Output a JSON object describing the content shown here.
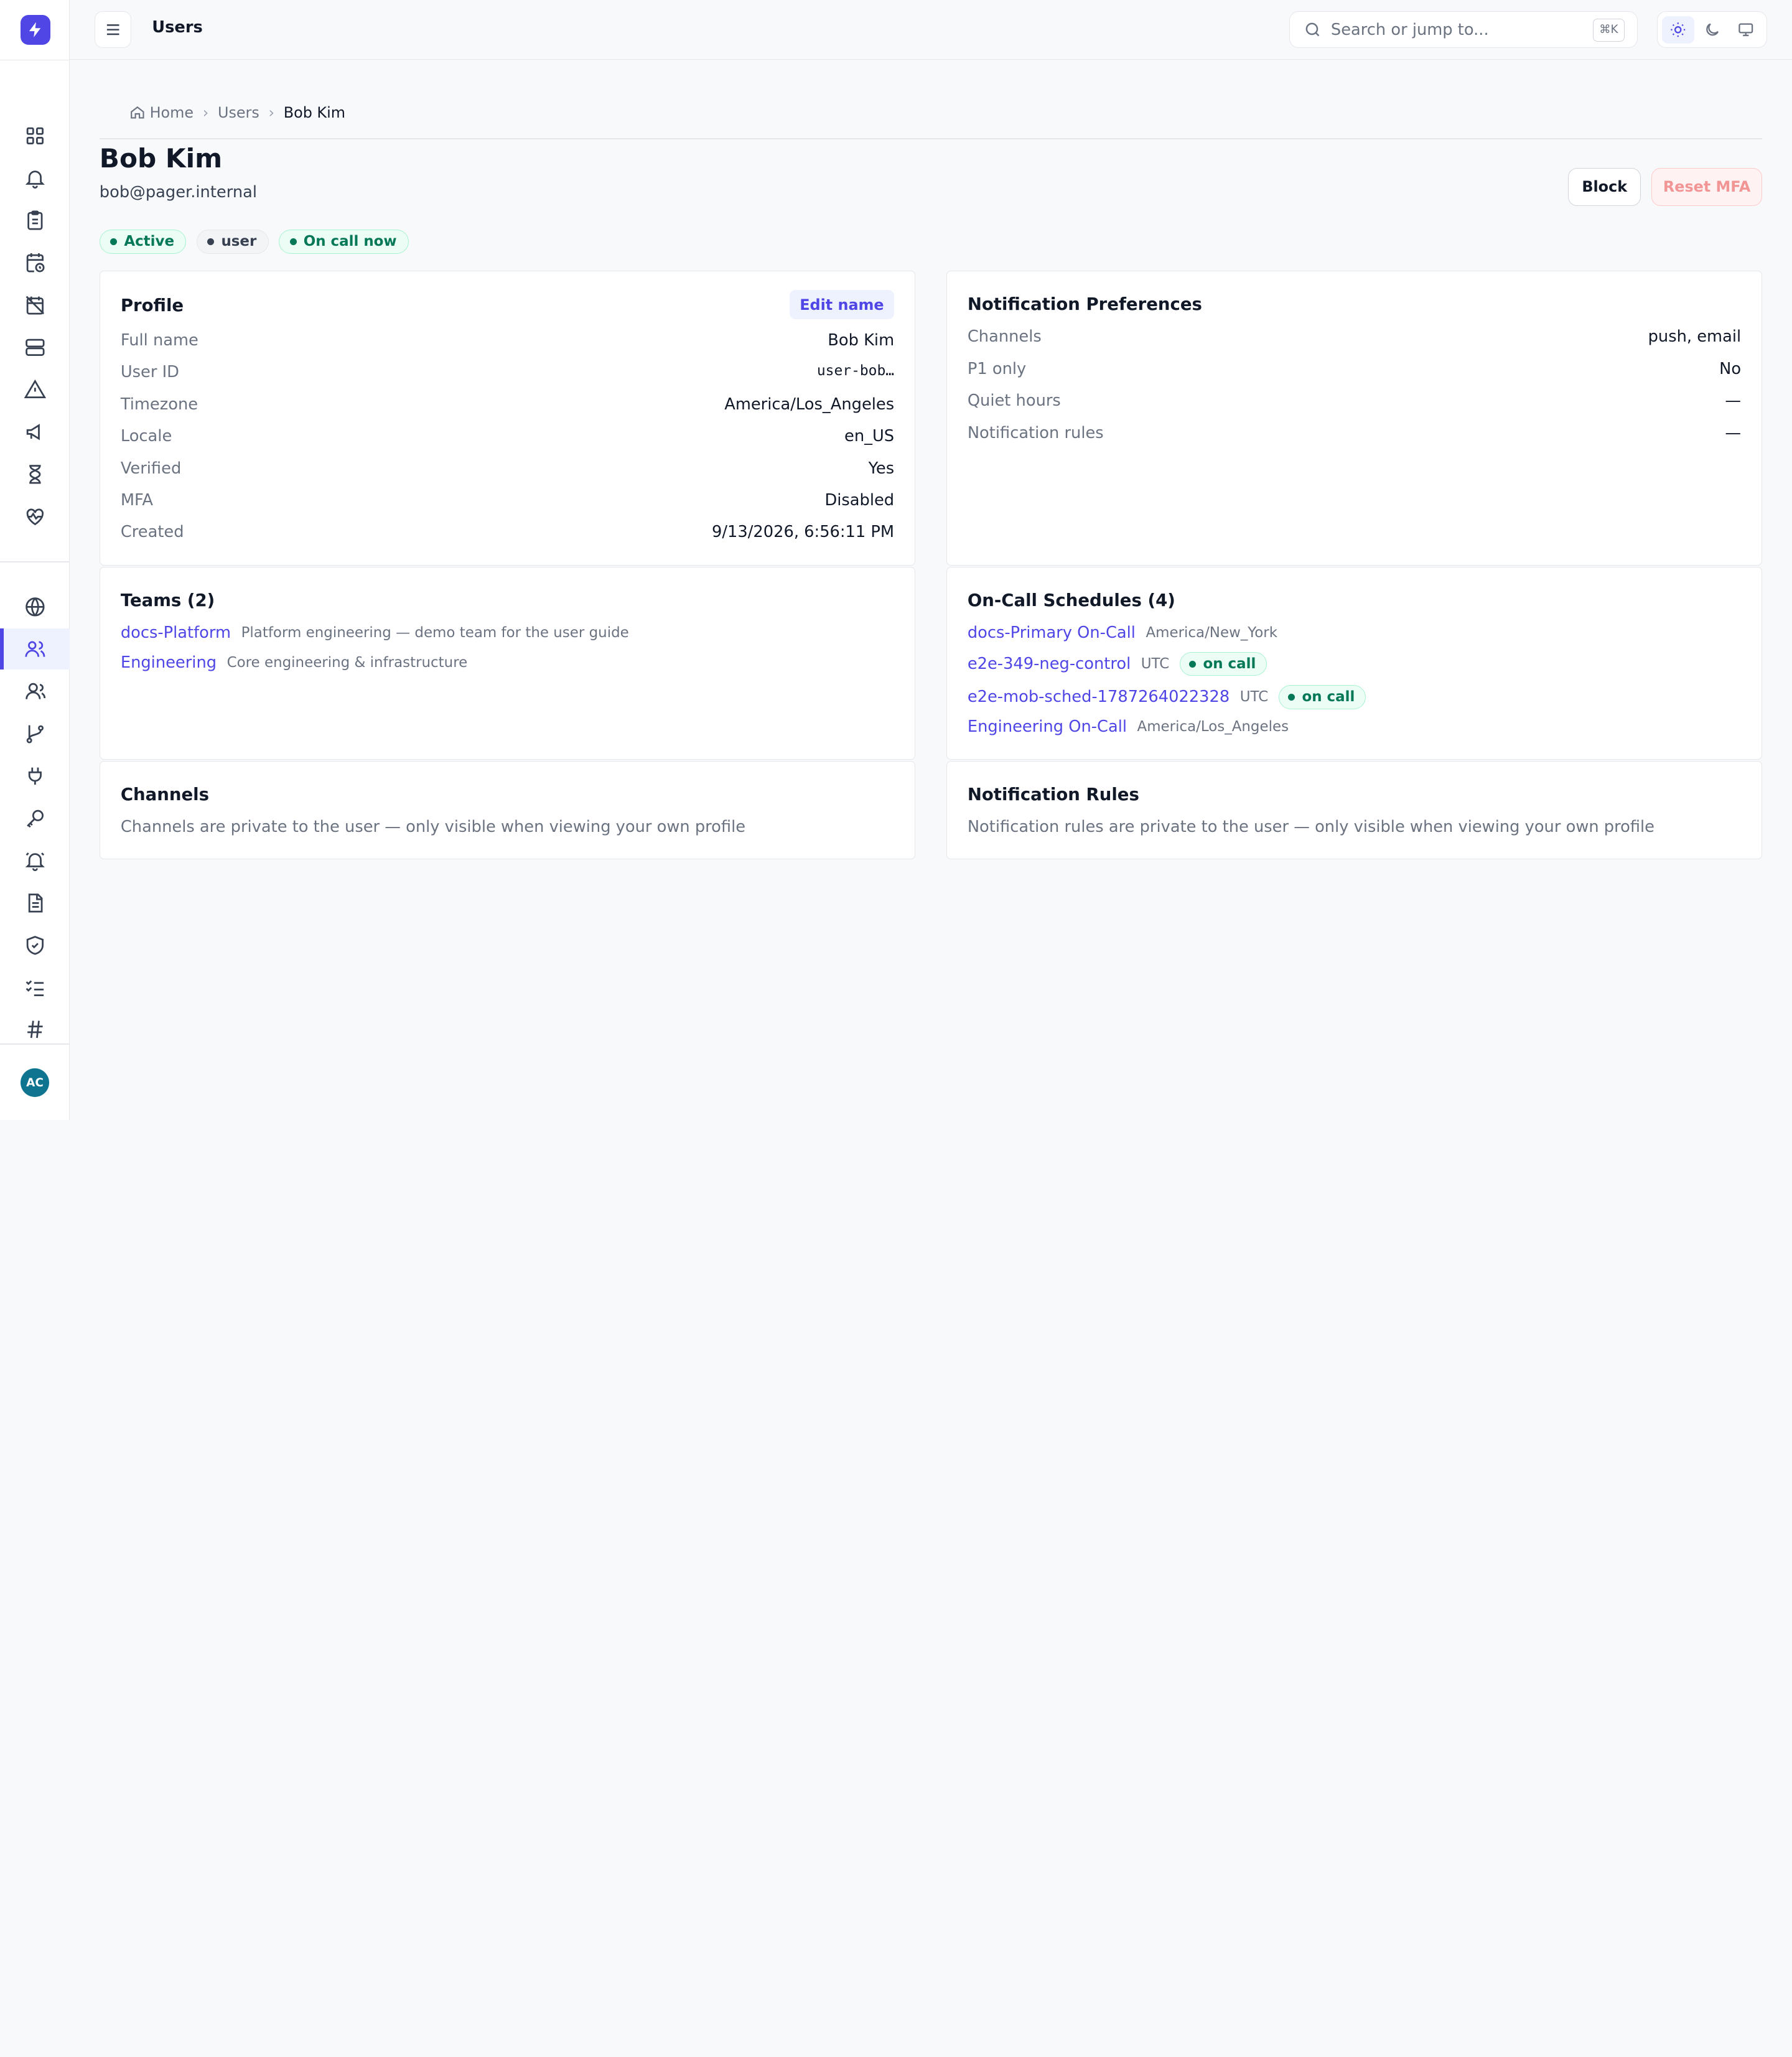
{
  "app": {
    "avatar_initials": "AC",
    "accent_color": "#4f46e5"
  },
  "topbar": {
    "title": "Users",
    "search_placeholder": "Search or jump to...",
    "search_shortcut": "⌘K"
  },
  "breadcrumb": {
    "home": "Home",
    "users": "Users",
    "current": "Bob Kim"
  },
  "user": {
    "name": "Bob Kim",
    "email": "bob@pager.internal",
    "badges": [
      "Active",
      "user",
      "On call now"
    ]
  },
  "actions": {
    "block": "Block",
    "reset_mfa": "Reset MFA"
  },
  "profile": {
    "title": "Profile",
    "edit_label": "Edit name",
    "rows": [
      {
        "key": "Full name",
        "value": "Bob Kim"
      },
      {
        "key": "User ID",
        "value": "user-bob…"
      },
      {
        "key": "Timezone",
        "value": "America/Los_Angeles"
      },
      {
        "key": "Locale",
        "value": "en_US"
      },
      {
        "key": "Verified",
        "value": "Yes"
      },
      {
        "key": "MFA",
        "value": "Disabled"
      },
      {
        "key": "Created",
        "value": "9/13/2026, 6:56:11 PM"
      }
    ]
  },
  "prefs": {
    "title": "Notification Preferences",
    "rows": [
      {
        "key": "Channels",
        "value": "push, email"
      },
      {
        "key": "P1 only",
        "value": "No"
      },
      {
        "key": "Quiet hours",
        "value": "—"
      },
      {
        "key": "Notification rules",
        "value": "—"
      }
    ]
  },
  "teams": {
    "title": "Teams (2)",
    "items": [
      {
        "name": "docs-Platform",
        "desc": "Platform engineering — demo team for the user guide"
      },
      {
        "name": "Engineering",
        "desc": "Core engineering & infrastructure"
      }
    ]
  },
  "schedules": {
    "title": "On-Call Schedules (4)",
    "oncall_label": "on call",
    "items": [
      {
        "name": "docs-Primary On-Call",
        "tz": "America/New_York"
      },
      {
        "name": "e2e-349-neg-control",
        "tz": "UTC"
      },
      {
        "name": "e2e-mob-sched-1787264022328",
        "tz": "UTC"
      },
      {
        "name": "Engineering On-Call",
        "tz": "America/Los_Angeles"
      }
    ]
  },
  "channels": {
    "title": "Channels",
    "note": "Channels are private to the user — only visible when viewing your own profile"
  },
  "rules": {
    "title": "Notification Rules",
    "note": "Notification rules are private to the user — only visible when viewing your own profile"
  }
}
